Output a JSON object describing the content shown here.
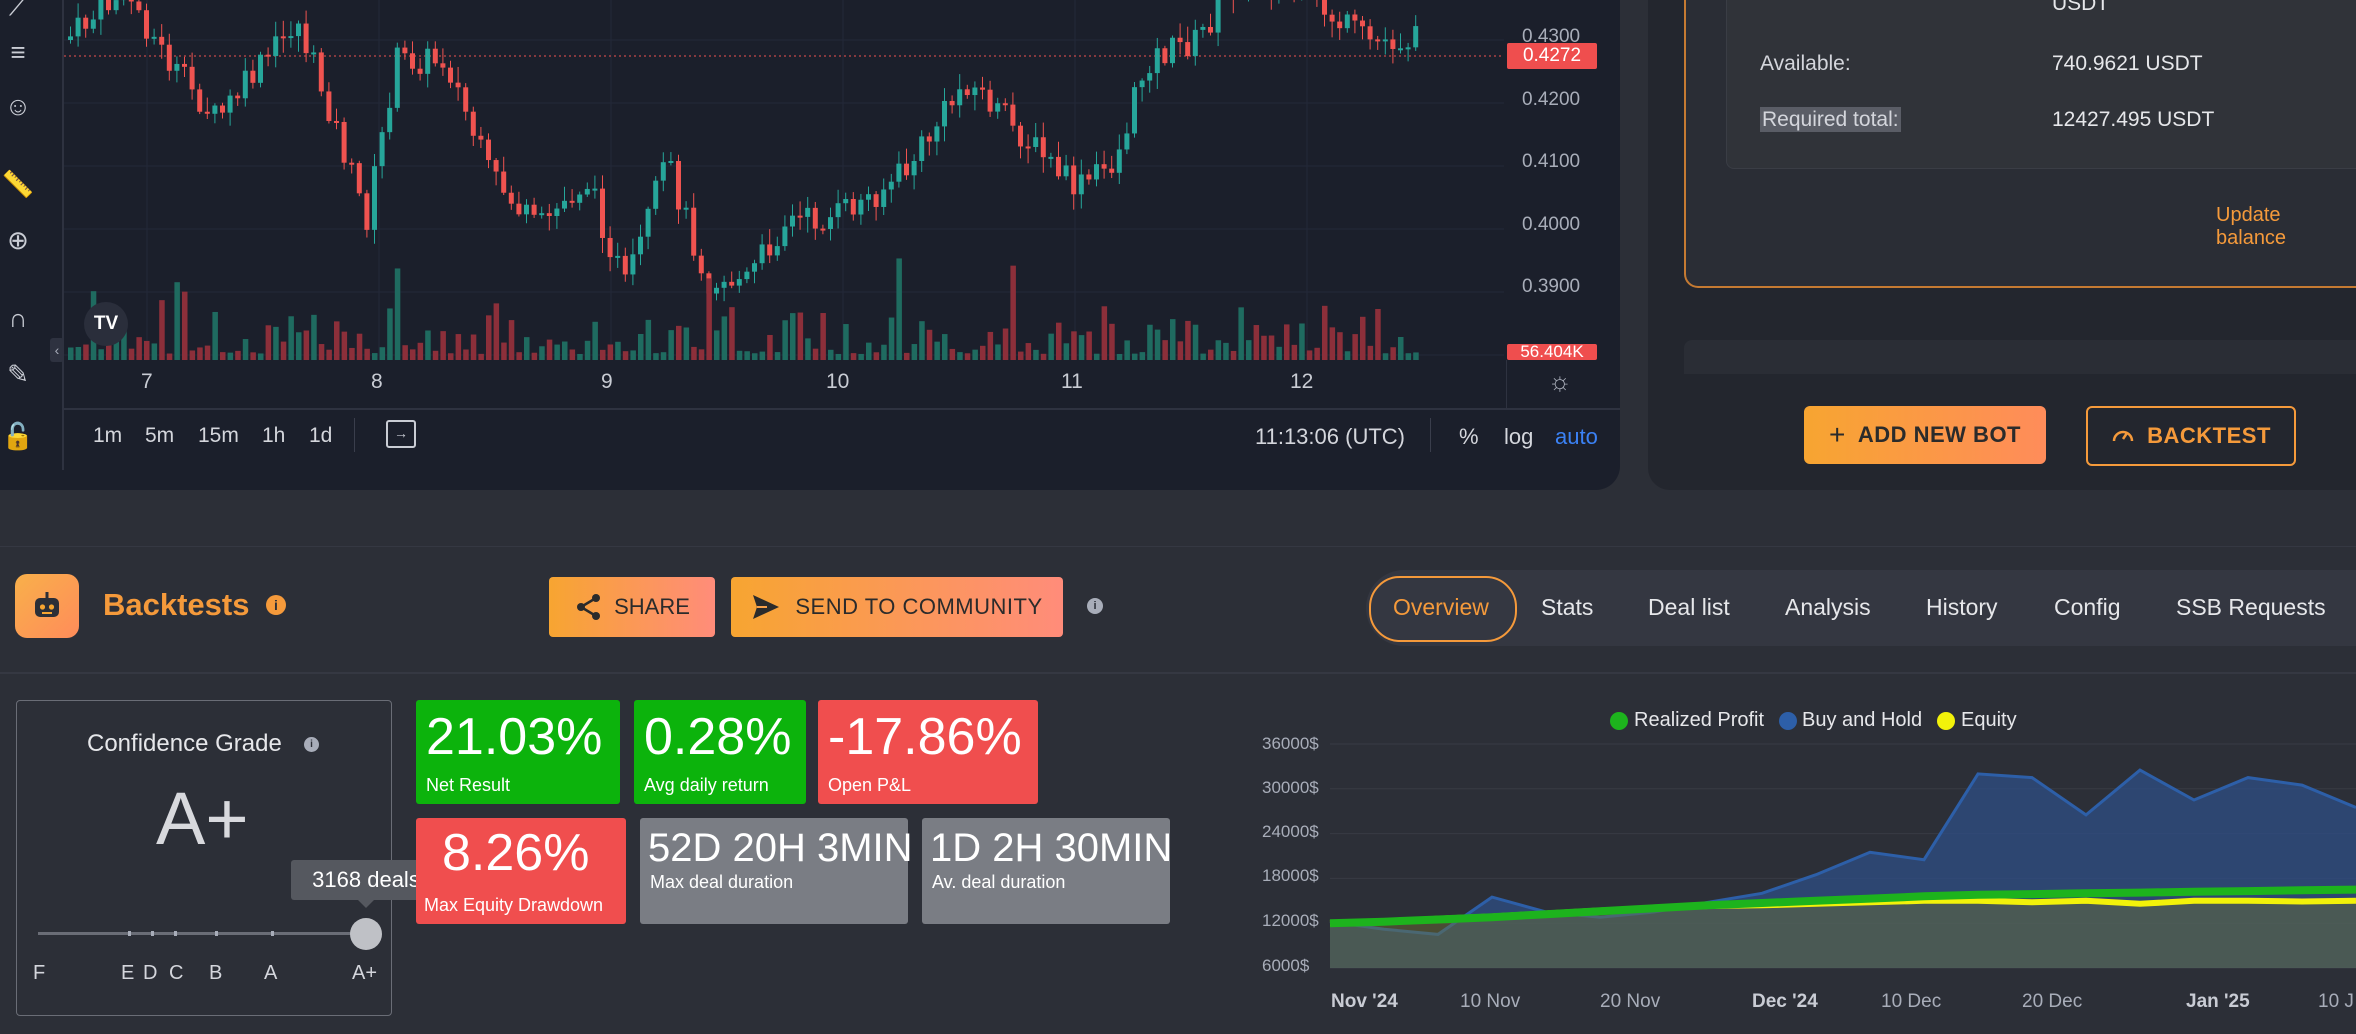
{
  "chart": {
    "price_ticks": [
      "0.4300",
      "0.4200",
      "0.4100",
      "0.4000",
      "0.3900"
    ],
    "current_price": "0.4272",
    "volume_tag": "56.404K",
    "dates": [
      "7",
      "8",
      "9",
      "10",
      "11",
      "12"
    ],
    "intervals": [
      "1m",
      "5m",
      "15m",
      "1h",
      "1d"
    ],
    "clock": "11:13:06 (UTC)",
    "scale_options": [
      "%",
      "log",
      "auto"
    ],
    "logo": "TV",
    "colors": {
      "up": "#26a69a",
      "down": "#ef5350",
      "volume_up": "#1f6b60",
      "volume_down": "#8c2f3a",
      "auto": "#3b82f6"
    }
  },
  "bot_panel": {
    "currency_top": "USDT",
    "available_label": "Available:",
    "available_value": "740.9621 USDT",
    "required_label": "Required total:",
    "required_value": "12427.495 USDT",
    "update_link": "Update balance",
    "add_bot_label": "ADD NEW BOT",
    "backtest_label": "BACKTEST"
  },
  "backtests": {
    "title": "Backtests",
    "share_label": "SHARE",
    "community_label": "SEND TO COMMUNITY",
    "tabs": [
      "Overview",
      "Stats",
      "Deal list",
      "Analysis",
      "History",
      "Config",
      "SSB Requests"
    ],
    "active_tab": "Overview"
  },
  "grade": {
    "title": "Confidence Grade",
    "value": "A+",
    "tooltip": "3168 deals",
    "scale": [
      "F",
      "E",
      "D",
      "C",
      "B",
      "A",
      "A+"
    ],
    "level": 1.0
  },
  "stats": [
    {
      "value": "21.03%",
      "label": "Net Result",
      "color": "green"
    },
    {
      "value": "0.28%",
      "label": "Avg daily return",
      "color": "green"
    },
    {
      "value": "-17.86%",
      "label": "Open P&L",
      "color": "red"
    },
    {
      "value": "8.26%",
      "label": "Max Equity Drawdown",
      "color": "red"
    },
    {
      "value": "52D 20H 3MIN",
      "label": "Max deal duration",
      "color": "grey"
    },
    {
      "value": "1D 2H 30MIN",
      "label": "Av. deal duration",
      "color": "grey"
    }
  ],
  "chart_data": {
    "type": "area",
    "legend": [
      "Realized Profit",
      "Buy and Hold",
      "Equity"
    ],
    "legend_colors": [
      "#1db31d",
      "#2d5fa8",
      "#f2f20a"
    ],
    "y_ticks": [
      "36000$",
      "30000$",
      "24000$",
      "18000$",
      "12000$",
      "6000$"
    ],
    "x_ticks": [
      "Nov '24",
      "10 Nov",
      "20 Nov",
      "Dec '24",
      "10 Dec",
      "20 Dec",
      "Jan '25",
      "10 J"
    ],
    "x_ticks_bold": [
      true,
      false,
      false,
      true,
      false,
      false,
      true,
      false
    ],
    "ylim": [
      6000,
      36000
    ],
    "series": [
      {
        "name": "Buy and Hold",
        "values": [
          12200,
          11200,
          10500,
          15500,
          13500,
          12800,
          13500,
          14800,
          16000,
          18500,
          21500,
          20500,
          32000,
          31500,
          26500,
          32500,
          28500,
          31500,
          30500,
          27500
        ]
      },
      {
        "name": "Equity",
        "values": [
          12000,
          12200,
          12600,
          12900,
          13300,
          13700,
          14000,
          14300,
          14400,
          14600,
          14800,
          15000,
          15000,
          14800,
          15000,
          14600,
          15000,
          15000,
          14900,
          15000
        ]
      },
      {
        "name": "Realized Profit",
        "values": [
          12000,
          12200,
          12500,
          12800,
          13200,
          13600,
          14000,
          14400,
          14700,
          15000,
          15300,
          15600,
          15800,
          15900,
          16000,
          16100,
          16200,
          16300,
          16400,
          16500
        ]
      }
    ]
  }
}
